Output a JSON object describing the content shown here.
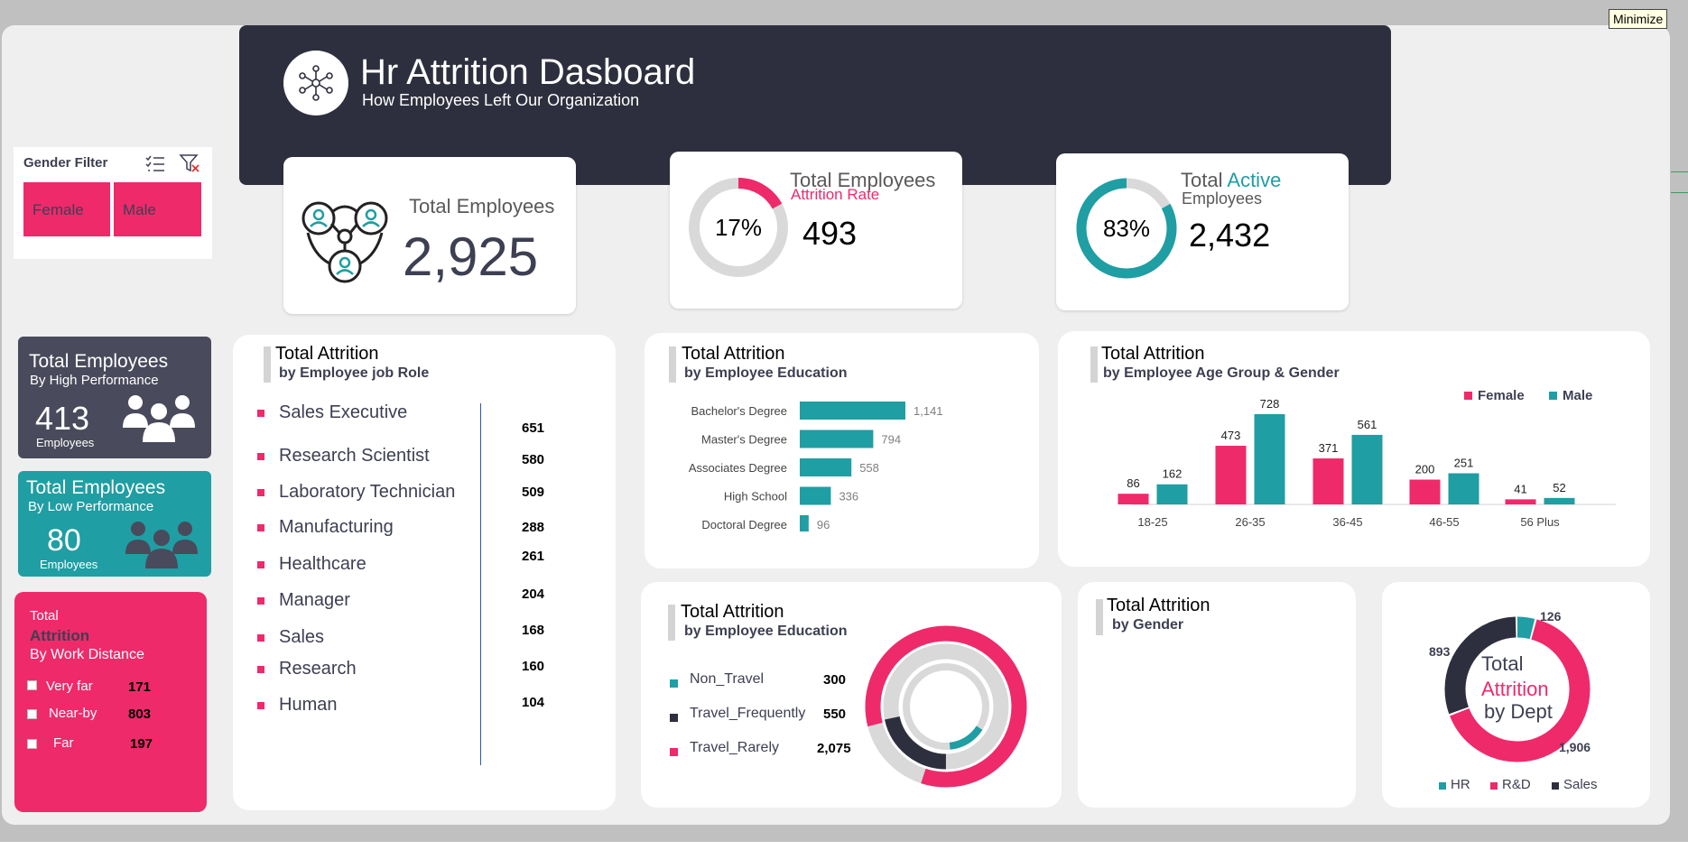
{
  "window": {
    "minimize_label": "Minimize"
  },
  "header": {
    "title": "Hr Attrition Dasboard",
    "subtitle": "How Employees Left Our Organization"
  },
  "gender_filter": {
    "title": "Gender Filter",
    "options": [
      "Female",
      "Male"
    ]
  },
  "kpi": {
    "total": {
      "label": "Total Employees",
      "value": "2,925"
    },
    "attrition": {
      "label_line1": "Total Employees",
      "label_line2": "Attrition Rate",
      "percent": "17%",
      "percent_value": 17,
      "value": "493"
    },
    "active": {
      "label_word1": "Total",
      "label_word2": "Active",
      "label_line2": "Employees",
      "percent": "83%",
      "percent_value": 83,
      "value": "2,432"
    }
  },
  "high_perf": {
    "title": "Total Employees",
    "subtitle": "By High Performance",
    "value": "413",
    "unit": "Employees"
  },
  "low_perf": {
    "title": "Total Employees",
    "subtitle": "By Low Performance",
    "value": "80",
    "unit": "Employees"
  },
  "work_distance": {
    "line1": "Total",
    "line2": "Attrition",
    "line3": "By Work Distance",
    "items": [
      {
        "label": "Very far",
        "value": "171"
      },
      {
        "label": "Near-by",
        "value": "803"
      },
      {
        "label": "Far",
        "value": "197"
      }
    ]
  },
  "job_role": {
    "title": "Total Attrition",
    "subtitle": "by Employee job Role",
    "items": [
      {
        "label": "Sales Executive",
        "value": "651"
      },
      {
        "label": "Research Scientist",
        "value": "580"
      },
      {
        "label": "Laboratory Technician",
        "value": "509"
      },
      {
        "label": "Manufacturing",
        "value": "288"
      },
      {
        "label": "Healthcare",
        "value": "261"
      },
      {
        "label": "Manager",
        "value": "204"
      },
      {
        "label": "Sales",
        "value": "168"
      },
      {
        "label": "Research",
        "value": "160"
      },
      {
        "label": "Human",
        "value": "104"
      }
    ]
  },
  "education": {
    "title": "Total Attrition",
    "subtitle": "by Employee Education"
  },
  "age_gender": {
    "title": "Total Attrition",
    "subtitle": "by Employee Age Group & Gender"
  },
  "travel": {
    "title": "Total Attrition",
    "subtitle": "by Employee Education",
    "items": [
      {
        "label": "Non_Travel",
        "value": "300",
        "color": "#1f9ea3"
      },
      {
        "label": "Travel_Frequently",
        "value": "550",
        "color": "#2e2f3e"
      },
      {
        "label": "Travel_Rarely",
        "value": "2,075",
        "color": "#ee2a6b"
      }
    ]
  },
  "gender_panel": {
    "title": "Total Attrition",
    "subtitle": "by Gender"
  },
  "dept": {
    "center_line1": "Total",
    "center_line2": "Attrition",
    "center_line3": "by Dept",
    "legend": [
      {
        "label": "HR",
        "color": "#1f9ea3"
      },
      {
        "label": "R&D",
        "color": "#ee2a6b"
      },
      {
        "label": "Sales",
        "color": "#2e2f3e"
      }
    ]
  },
  "chart_data": [
    {
      "type": "bar",
      "orientation": "horizontal",
      "title": "Total Attrition",
      "subtitle": "by Employee Education",
      "categories": [
        "Bachelor's Degree",
        "Master's Degree",
        "Associates Degree",
        "High School",
        "Doctoral Degree"
      ],
      "values": [
        1141,
        794,
        558,
        336,
        96
      ],
      "labels": [
        "1,141",
        "794",
        "558",
        "336",
        "96"
      ],
      "color": "#1f9ea3",
      "grid": false
    },
    {
      "type": "bar",
      "title": "Total Attrition",
      "subtitle": "by Employee Age Group & Gender",
      "categories": [
        "18-25",
        "26-35",
        "36-45",
        "46-55",
        "56 Plus"
      ],
      "series": [
        {
          "name": "Female",
          "values": [
            86,
            473,
            371,
            200,
            41
          ],
          "color": "#ee2a6b"
        },
        {
          "name": "Male",
          "values": [
            162,
            728,
            561,
            251,
            52
          ],
          "color": "#1f9ea3"
        }
      ],
      "legend": "top-right",
      "grid": false
    },
    {
      "type": "pie",
      "title": "Total Attrition",
      "subtitle": "by Employee Education",
      "categories": [
        "Non_Travel",
        "Travel_Frequently",
        "Travel_Rarely"
      ],
      "values": [
        300,
        550,
        2075
      ],
      "colors": [
        "#1f9ea3",
        "#2e2f3e",
        "#ee2a6b"
      ]
    },
    {
      "type": "pie",
      "categories": [
        "HR",
        "R&D",
        "Sales"
      ],
      "values": [
        126,
        1906,
        893
      ],
      "labels": [
        "126",
        "1,906",
        "893"
      ],
      "colors": [
        "#1f9ea3",
        "#ee2a6b",
        "#2e2f3e"
      ]
    }
  ]
}
